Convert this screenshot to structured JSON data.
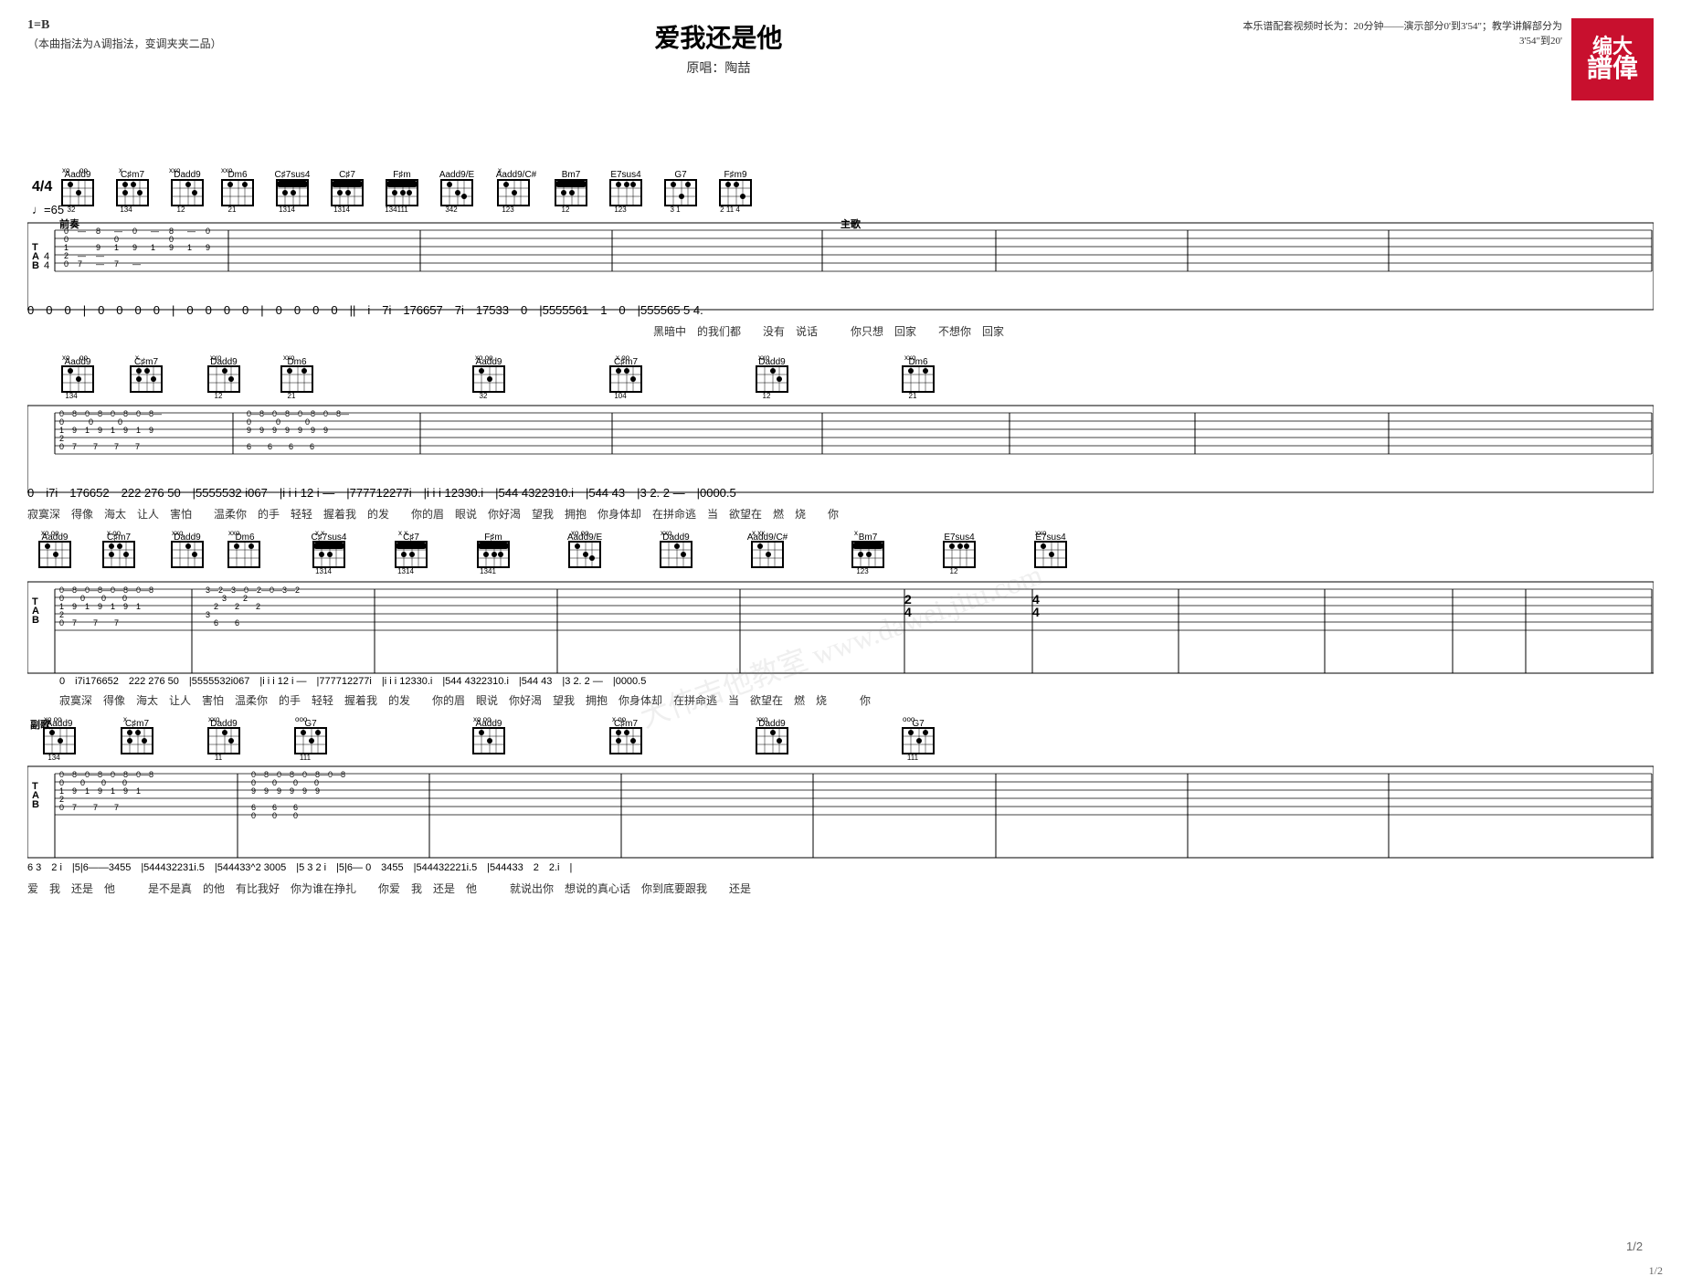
{
  "header": {
    "song_title": "爱我还是他",
    "original_singer_label": "原唱：陶喆",
    "video_note": "本乐谱配套视频时长为：20分钟——演示部分0'到3'54\"；教学讲解部分为3'54\"到20'",
    "tuning_note": "（本曲指法为A调指法，变调夹夹二品）",
    "key": "1=B",
    "time_sig": "4/4",
    "tempo": "♩=65"
  },
  "logo": {
    "top": "编大",
    "bottom": "譜偉"
  },
  "page_number": "1/2",
  "watermark": "大伟吉他教室 www.dawei.jitu.com"
}
